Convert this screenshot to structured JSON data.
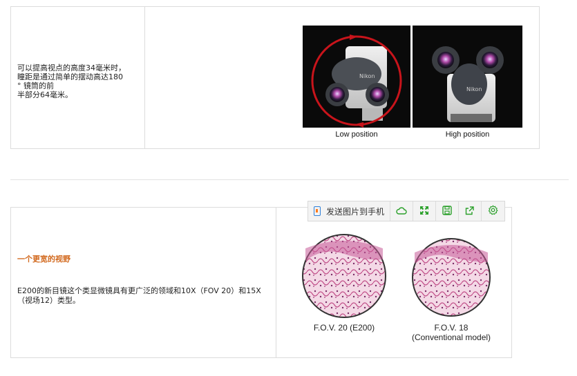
{
  "section1": {
    "text_lines": [
      "可以提高视点的高度34毫米时，",
      "瞳距是通过简单的摆动高达180",
      "° 镜筒的前",
      "半部分64毫米。"
    ],
    "photo_captions": {
      "left": "Low position",
      "right": "High position"
    }
  },
  "section2": {
    "heading": "一个更宽的视野",
    "description": "E200的新目镜这个类显微镜具有更广泛的领域和10X（FOV 20）和15X（视场12）类型。",
    "fov_labels": {
      "left": "F.O.V. 20 (E200)",
      "right_line1": "F.O.V. 18",
      "right_line2": "(Conventional model)"
    }
  },
  "toolbar": {
    "send_label": "发送图片到手机",
    "icons": [
      "cloud-icon",
      "expand-icon",
      "save-icon",
      "share-icon",
      "settings-icon"
    ],
    "accent": "#2aa02a"
  }
}
